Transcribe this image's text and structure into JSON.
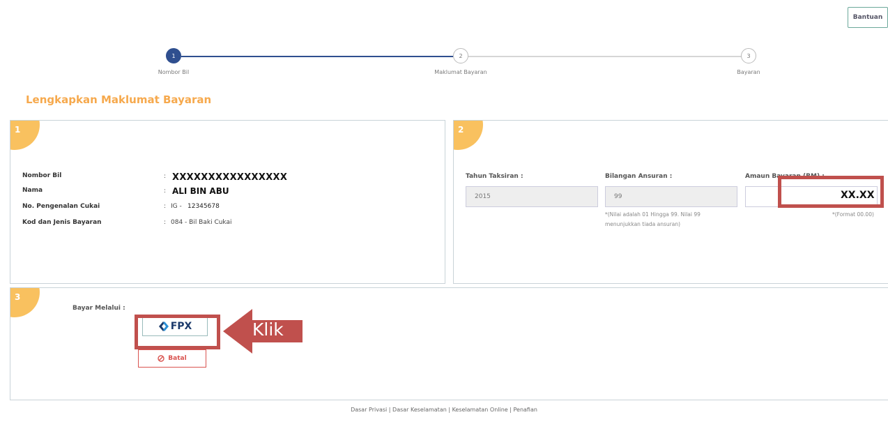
{
  "header": {
    "help_label": "Bantuan"
  },
  "stepper": {
    "steps": [
      {
        "number": "1",
        "label": "Nombor Bil"
      },
      {
        "number": "2",
        "label": "Maklumat Bayaran"
      },
      {
        "number": "3",
        "label": "Bayaran"
      }
    ]
  },
  "page_title": "Lengkapkan Maklumat Bayaran",
  "section1": {
    "number": "1",
    "rows": [
      {
        "label": "Nombor Bil",
        "colon": ":",
        "value": "XXXXXXXXXXXXXXXX"
      },
      {
        "label": "Nama",
        "colon": ":",
        "value": "ALI BIN ABU"
      },
      {
        "label": "No. Pengenalan Cukai",
        "colon": ":",
        "prefix": "IG -",
        "value": "12345678"
      },
      {
        "label": "Kod dan Jenis Bayaran",
        "colon": ":",
        "value": "084 - Bil Baki Cukai"
      }
    ]
  },
  "section2": {
    "number": "2",
    "fields": [
      {
        "label": "Tahun Taksiran :",
        "value": "2015"
      },
      {
        "label": "Bilangan Ansuran :",
        "value": "99",
        "note_line1": "*(Nilai adalah 01 Hingga 99. Nilai 99",
        "note_line2": "menunjukkan tiada ansuran)"
      },
      {
        "label": "Amaun Bayaran (RM) :",
        "value": "XX.XX",
        "note": "*(Format 00.00)"
      }
    ]
  },
  "section3": {
    "number": "3",
    "pay_label": "Bayar Melalui  :",
    "fpx_label": "FPX",
    "cancel_label": "Batal"
  },
  "annotation": {
    "label": "Klik",
    "color": "#c0504d"
  },
  "footer": {
    "text": "Dasar Privasi | Dasar Keselamatan | Keselamatan Online | Penafian"
  },
  "colors": {
    "accent": "#f6a94d",
    "badge": "#f9c15f",
    "primary": "#2f4f8f",
    "danger": "#d9534f"
  }
}
